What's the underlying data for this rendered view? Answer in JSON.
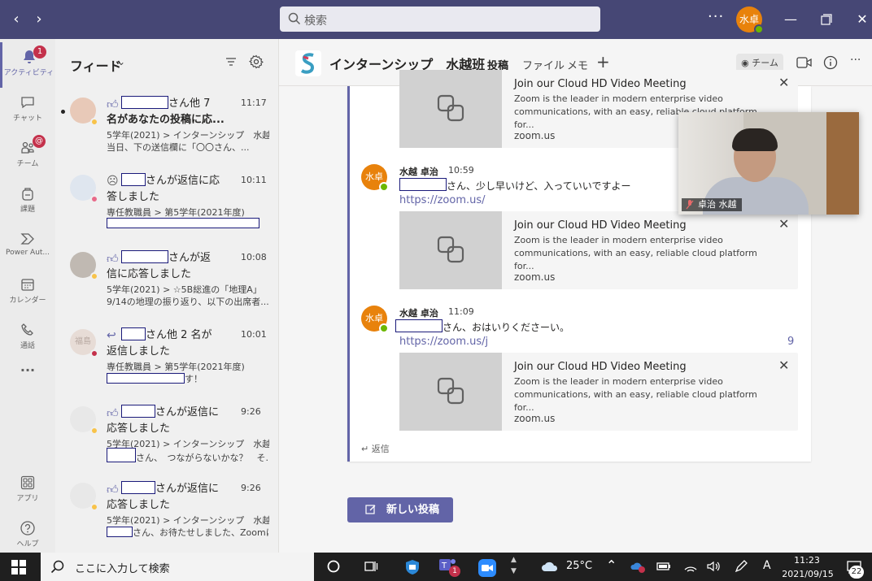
{
  "titlebar": {
    "search_placeholder": "検索",
    "avatar_text": "水卓",
    "more": "···"
  },
  "rail": {
    "items": [
      {
        "label": "アクティビティ",
        "badge": "1"
      },
      {
        "label": "チャット"
      },
      {
        "label": "チーム",
        "badge": "@"
      },
      {
        "label": "課題"
      },
      {
        "label": "Power Aut..."
      },
      {
        "label": "カレンダー"
      },
      {
        "label": "通話"
      },
      {
        "label": "···"
      },
      {
        "label": "アプリ"
      },
      {
        "label": "ヘルプ"
      }
    ]
  },
  "feed": {
    "title": "フィード",
    "items": [
      {
        "line1": "さん他 7",
        "line2": "名があなたの投稿に応...",
        "time": "11:17",
        "sub1": "5学年(2021) > インターンシップ　水越班",
        "sub2": "当日、下の送信欄に「〇〇さん、...",
        "unread": true
      },
      {
        "line1": "さんが返信に応",
        "line2": "答しました",
        "time": "10:11",
        "sub1": "専任教職員 > 第5学年(2021年度)",
        "sub2": ""
      },
      {
        "line1": "さんが返",
        "line2": "信に応答しました",
        "time": "10:08",
        "sub1": "5学年(2021) > ☆5B総進の「地理A」",
        "sub2": "9/14の地理の振り返り、以下の出席者..."
      },
      {
        "line1": "さん他 2 名が",
        "line2": "返信しました",
        "time": "10:01",
        "sub1": "専任教職員 > 第5学年(2021年度)",
        "sub2": "す！",
        "avatar_text": "福島"
      },
      {
        "line1": "さんが返信に",
        "line2": "応答しました",
        "time": "9:26",
        "sub1": "5学年(2021) > インターンシップ　水越班",
        "sub2": "さん、　つながらないかな？　そ..."
      },
      {
        "line1": "さんが返信に",
        "line2": "応答しました",
        "time": "9:26",
        "sub1": "5学年(2021) > インターンシップ　水越班",
        "sub2": "さん、お待たせしました、Zoomに..."
      }
    ]
  },
  "channel": {
    "team_name": "インターンシップ　水越班",
    "tabs": [
      "投稿",
      "ファイル",
      "メモ"
    ],
    "plus": "+",
    "team_button": "チーム"
  },
  "thread": {
    "previews": [
      {
        "title": "Join our Cloud HD Video Meeting",
        "desc": "Zoom is the leader in modern enterprise video communications, with an easy, reliable cloud platform for...",
        "host": "zoom.us"
      },
      {
        "title": "Join our Cloud HD Video Meeting",
        "desc": "Zoom is the leader in modern enterprise video communications, with an easy, reliable cloud platform for...",
        "host": "zoom.us"
      },
      {
        "title": "Join our Cloud HD Video Meeting",
        "desc": "Zoom is the leader in modern enterprise video communications, with an easy, reliable cloud platform for...",
        "host": "zoom.us"
      }
    ],
    "messages": [
      {
        "avatar": "水卓",
        "name": "水越 卓治",
        "time": "10:59",
        "text": "さん、少し早いけど、入っていいですよー",
        "link": "https://zoom.us/"
      },
      {
        "avatar": "水卓",
        "name": "水越 卓治",
        "time": "11:09",
        "text": "さん、おはいりくださーい。",
        "link": "https://zoom.us/j",
        "link_tail": "9"
      }
    ],
    "reply": "返信"
  },
  "new_post": "新しい投稿",
  "video": {
    "name": "卓治 水越"
  },
  "taskbar": {
    "search_placeholder": "ここに入力して検索",
    "temperature": "25°C",
    "ime": "A",
    "time": "11:23",
    "date": "2021/09/15",
    "notifications": "22",
    "teams_badge": "1"
  }
}
